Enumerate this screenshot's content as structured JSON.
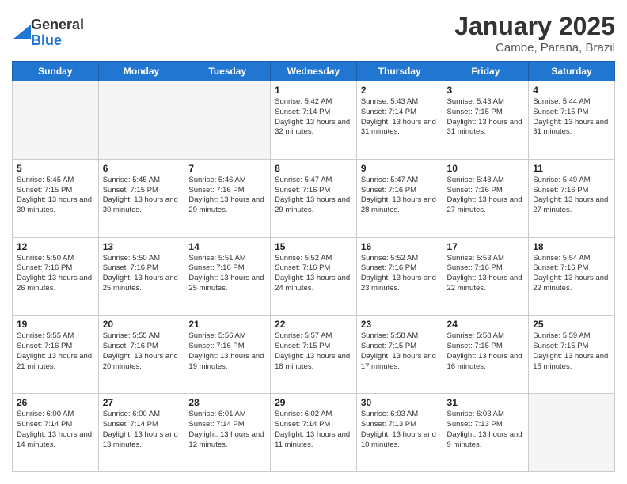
{
  "logo": {
    "general": "General",
    "blue": "Blue"
  },
  "title": "January 2025",
  "location": "Cambe, Parana, Brazil",
  "days_of_week": [
    "Sunday",
    "Monday",
    "Tuesday",
    "Wednesday",
    "Thursday",
    "Friday",
    "Saturday"
  ],
  "weeks": [
    [
      {
        "day": "",
        "info": ""
      },
      {
        "day": "",
        "info": ""
      },
      {
        "day": "",
        "info": ""
      },
      {
        "day": "1",
        "info": "Sunrise: 5:42 AM\nSunset: 7:14 PM\nDaylight: 13 hours\nand 32 minutes."
      },
      {
        "day": "2",
        "info": "Sunrise: 5:43 AM\nSunset: 7:14 PM\nDaylight: 13 hours\nand 31 minutes."
      },
      {
        "day": "3",
        "info": "Sunrise: 5:43 AM\nSunset: 7:15 PM\nDaylight: 13 hours\nand 31 minutes."
      },
      {
        "day": "4",
        "info": "Sunrise: 5:44 AM\nSunset: 7:15 PM\nDaylight: 13 hours\nand 31 minutes."
      }
    ],
    [
      {
        "day": "5",
        "info": "Sunrise: 5:45 AM\nSunset: 7:15 PM\nDaylight: 13 hours\nand 30 minutes."
      },
      {
        "day": "6",
        "info": "Sunrise: 5:45 AM\nSunset: 7:15 PM\nDaylight: 13 hours\nand 30 minutes."
      },
      {
        "day": "7",
        "info": "Sunrise: 5:46 AM\nSunset: 7:16 PM\nDaylight: 13 hours\nand 29 minutes."
      },
      {
        "day": "8",
        "info": "Sunrise: 5:47 AM\nSunset: 7:16 PM\nDaylight: 13 hours\nand 29 minutes."
      },
      {
        "day": "9",
        "info": "Sunrise: 5:47 AM\nSunset: 7:16 PM\nDaylight: 13 hours\nand 28 minutes."
      },
      {
        "day": "10",
        "info": "Sunrise: 5:48 AM\nSunset: 7:16 PM\nDaylight: 13 hours\nand 27 minutes."
      },
      {
        "day": "11",
        "info": "Sunrise: 5:49 AM\nSunset: 7:16 PM\nDaylight: 13 hours\nand 27 minutes."
      }
    ],
    [
      {
        "day": "12",
        "info": "Sunrise: 5:50 AM\nSunset: 7:16 PM\nDaylight: 13 hours\nand 26 minutes."
      },
      {
        "day": "13",
        "info": "Sunrise: 5:50 AM\nSunset: 7:16 PM\nDaylight: 13 hours\nand 25 minutes."
      },
      {
        "day": "14",
        "info": "Sunrise: 5:51 AM\nSunset: 7:16 PM\nDaylight: 13 hours\nand 25 minutes."
      },
      {
        "day": "15",
        "info": "Sunrise: 5:52 AM\nSunset: 7:16 PM\nDaylight: 13 hours\nand 24 minutes."
      },
      {
        "day": "16",
        "info": "Sunrise: 5:52 AM\nSunset: 7:16 PM\nDaylight: 13 hours\nand 23 minutes."
      },
      {
        "day": "17",
        "info": "Sunrise: 5:53 AM\nSunset: 7:16 PM\nDaylight: 13 hours\nand 22 minutes."
      },
      {
        "day": "18",
        "info": "Sunrise: 5:54 AM\nSunset: 7:16 PM\nDaylight: 13 hours\nand 22 minutes."
      }
    ],
    [
      {
        "day": "19",
        "info": "Sunrise: 5:55 AM\nSunset: 7:16 PM\nDaylight: 13 hours\nand 21 minutes."
      },
      {
        "day": "20",
        "info": "Sunrise: 5:55 AM\nSunset: 7:16 PM\nDaylight: 13 hours\nand 20 minutes."
      },
      {
        "day": "21",
        "info": "Sunrise: 5:56 AM\nSunset: 7:16 PM\nDaylight: 13 hours\nand 19 minutes."
      },
      {
        "day": "22",
        "info": "Sunrise: 5:57 AM\nSunset: 7:15 PM\nDaylight: 13 hours\nand 18 minutes."
      },
      {
        "day": "23",
        "info": "Sunrise: 5:58 AM\nSunset: 7:15 PM\nDaylight: 13 hours\nand 17 minutes."
      },
      {
        "day": "24",
        "info": "Sunrise: 5:58 AM\nSunset: 7:15 PM\nDaylight: 13 hours\nand 16 minutes."
      },
      {
        "day": "25",
        "info": "Sunrise: 5:59 AM\nSunset: 7:15 PM\nDaylight: 13 hours\nand 15 minutes."
      }
    ],
    [
      {
        "day": "26",
        "info": "Sunrise: 6:00 AM\nSunset: 7:14 PM\nDaylight: 13 hours\nand 14 minutes."
      },
      {
        "day": "27",
        "info": "Sunrise: 6:00 AM\nSunset: 7:14 PM\nDaylight: 13 hours\nand 13 minutes."
      },
      {
        "day": "28",
        "info": "Sunrise: 6:01 AM\nSunset: 7:14 PM\nDaylight: 13 hours\nand 12 minutes."
      },
      {
        "day": "29",
        "info": "Sunrise: 6:02 AM\nSunset: 7:14 PM\nDaylight: 13 hours\nand 11 minutes."
      },
      {
        "day": "30",
        "info": "Sunrise: 6:03 AM\nSunset: 7:13 PM\nDaylight: 13 hours\nand 10 minutes."
      },
      {
        "day": "31",
        "info": "Sunrise: 6:03 AM\nSunset: 7:13 PM\nDaylight: 13 hours\nand 9 minutes."
      },
      {
        "day": "",
        "info": ""
      }
    ]
  ]
}
